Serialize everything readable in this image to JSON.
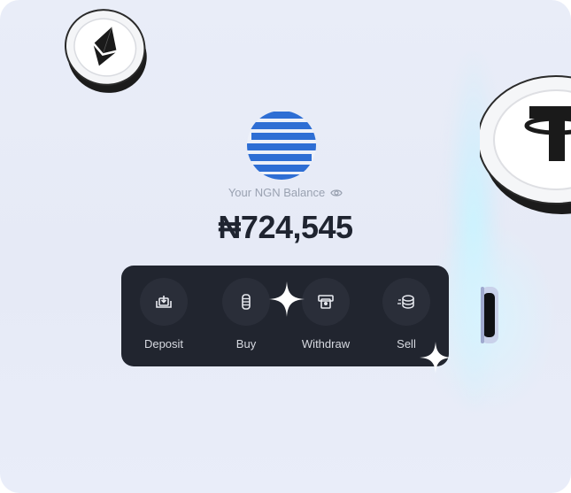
{
  "wallet": {
    "currency_logo": "blue-striped-globe-logo",
    "balance_label": "Your NGN Balance",
    "balance_amount": "₦724,545",
    "visibility_icon": "eye-icon"
  },
  "actions": [
    {
      "label": "Deposit",
      "icon": "deposit-icon"
    },
    {
      "label": "Buy",
      "icon": "coin-stack-icon"
    },
    {
      "label": "Withdraw",
      "icon": "withdraw-icon"
    },
    {
      "label": "Sell",
      "icon": "sell-coins-icon"
    }
  ],
  "decorations": {
    "coins": [
      "ethereum-coin",
      "tether-coin",
      "coin-edge"
    ],
    "sparkles": [
      "sparkle",
      "sparkle"
    ]
  },
  "colors": {
    "background": "#e8ecf7",
    "panel": "#21252f",
    "brand_blue": "#2f6fd6",
    "amount_text": "#1f2430"
  }
}
